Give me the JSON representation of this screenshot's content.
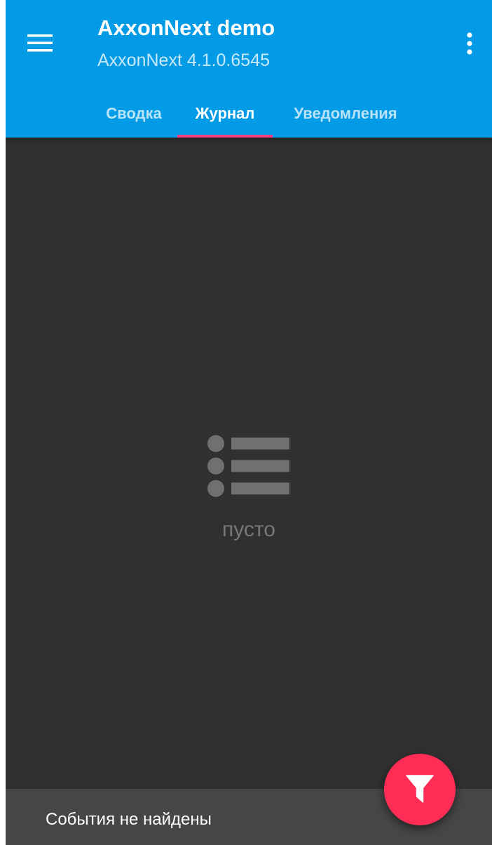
{
  "app_bar": {
    "title": "AxxonNext demo",
    "subtitle": "AxxonNext 4.1.0.6545",
    "color": "#039be5"
  },
  "tabs": [
    {
      "label": "Сводка",
      "active": false
    },
    {
      "label": "Журнал",
      "active": true
    },
    {
      "label": "Уведомления",
      "active": false
    }
  ],
  "tab_indicator_color": "#ff4081",
  "empty_state": {
    "icon": "list-icon",
    "text": "пусто"
  },
  "snackbar": {
    "text": "События не найдены"
  },
  "fab": {
    "icon": "filter-icon",
    "color": "#ff2d55"
  }
}
